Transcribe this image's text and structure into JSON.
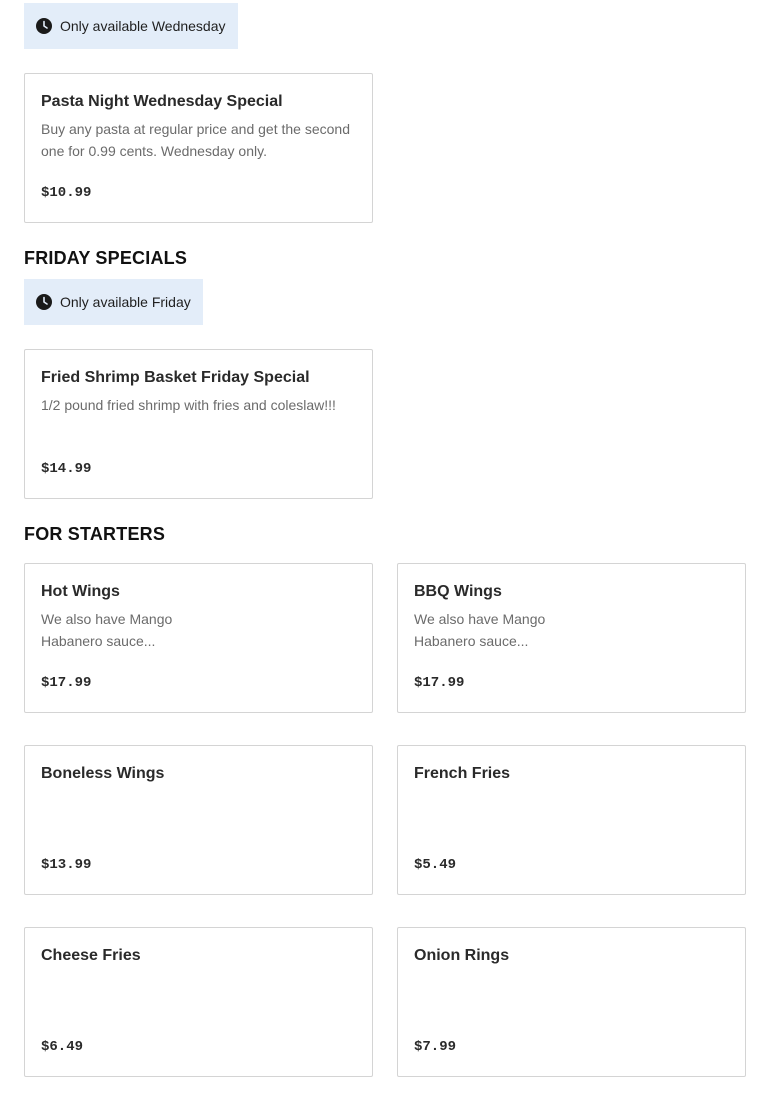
{
  "wednesday": {
    "badge": "Only available Wednesday",
    "items": [
      {
        "name": "Pasta Night Wednesday Special",
        "desc_lines": [
          "Buy any pasta at regular price and get the second",
          "one for 0.99 cents. Wednesday only."
        ],
        "price": "$10.99"
      }
    ]
  },
  "friday": {
    "title": "FRIDAY SPECIALS",
    "badge": "Only available Friday",
    "items": [
      {
        "name": "Fried Shrimp Basket Friday Special",
        "desc_lines": [
          "1/2 pound fried shrimp with fries and coleslaw!!!"
        ],
        "price": "$14.99"
      }
    ]
  },
  "starters": {
    "title": "FOR STARTERS",
    "items": [
      {
        "name": "Hot Wings",
        "desc_lines": [
          "We also have Mango",
          "Habanero sauce..."
        ],
        "price": "$17.99"
      },
      {
        "name": "BBQ Wings",
        "desc_lines": [
          "We also have Mango",
          "Habanero sauce..."
        ],
        "price": "$17.99"
      },
      {
        "name": "Boneless Wings",
        "desc_lines": [],
        "price": "$13.99"
      },
      {
        "name": "French Fries",
        "desc_lines": [],
        "price": "$5.49"
      },
      {
        "name": "Cheese Fries",
        "desc_lines": [],
        "price": "$6.49"
      },
      {
        "name": "Onion Rings",
        "desc_lines": [],
        "price": "$7.99"
      }
    ]
  },
  "icons": {
    "availability": "clock-icon"
  }
}
